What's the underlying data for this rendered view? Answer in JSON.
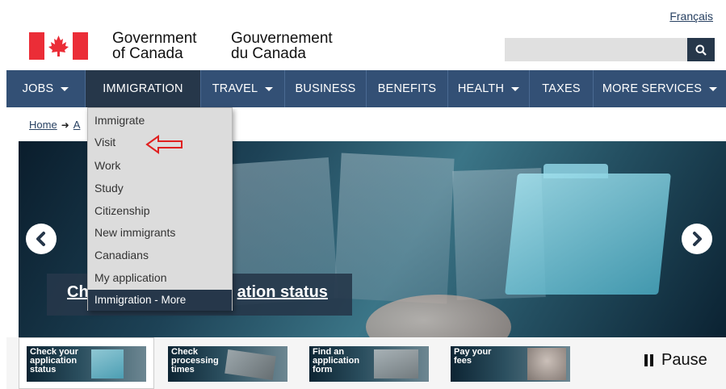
{
  "header": {
    "lang_link": "Français",
    "gov_en_line1": "Government",
    "gov_en_line2": "of Canada",
    "gov_fr_line1": "Gouvernement",
    "gov_fr_line2": "du Canada",
    "search_value": "",
    "flag_icon": "canada-flag-icon",
    "search_icon": "search-icon"
  },
  "nav": {
    "items": [
      {
        "label": "JOBS",
        "has_caret": true
      },
      {
        "label": "IMMIGRATION",
        "has_caret": false,
        "active": true
      },
      {
        "label": "TRAVEL",
        "has_caret": true
      },
      {
        "label": "BUSINESS",
        "has_caret": false
      },
      {
        "label": "BENEFITS",
        "has_caret": false
      },
      {
        "label": "HEALTH",
        "has_caret": true
      },
      {
        "label": "TAXES",
        "has_caret": false
      },
      {
        "label": "MORE SERVICES",
        "has_caret": true
      }
    ]
  },
  "breadcrumb": {
    "home": "Home",
    "next": "A"
  },
  "dropdown": {
    "items": [
      "Immigrate",
      "Visit",
      "Work",
      "Study",
      "Citizenship",
      "New immigrants",
      "Canadians",
      "My application"
    ],
    "more": "Immigration - More",
    "annotation_icon": "red-arrow-icon"
  },
  "carousel": {
    "caption_left": "Ch",
    "caption_right": "ation status",
    "prev_icon": "chevron-left-icon",
    "next_icon": "chevron-right-icon"
  },
  "thumbnails": [
    {
      "line1": "Check your",
      "line2": "application",
      "line3": "status"
    },
    {
      "line1": "Check",
      "line2": "processing",
      "line3": "times"
    },
    {
      "line1": "Find an",
      "line2": "application",
      "line3": "form"
    },
    {
      "line1": "Pay your",
      "line2": "fees",
      "line3": ""
    }
  ],
  "pause_label": "Pause",
  "colors": {
    "nav_bg": "#335075",
    "nav_active": "#26374a",
    "flag_red": "#eb2d37",
    "annotation_red": "#e02020"
  }
}
